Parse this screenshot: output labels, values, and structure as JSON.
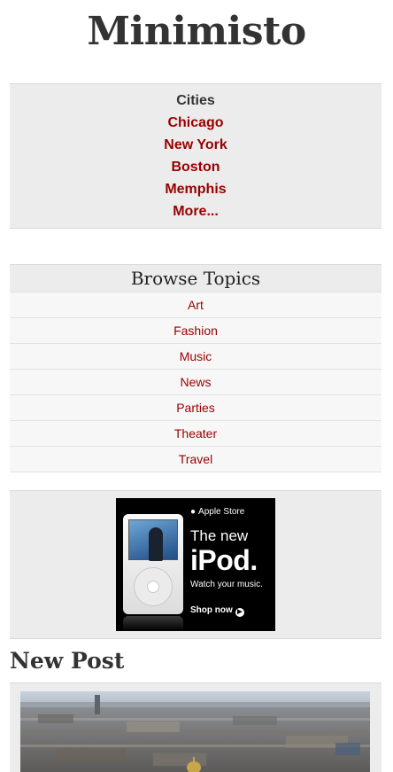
{
  "site": {
    "title": "Minimisto"
  },
  "cities": {
    "heading": "Cities",
    "links": [
      "Chicago",
      "New York",
      "Boston",
      "Memphis",
      "More..."
    ]
  },
  "topics": {
    "heading": "Browse Topics",
    "items": [
      "Art",
      "Fashion",
      "Music",
      "News",
      "Parties",
      "Theater",
      "Travel"
    ]
  },
  "ad": {
    "store": "Apple Store",
    "line1": "The new",
    "line2": "iPod.",
    "line3": "Watch your music.",
    "cta": "Shop now"
  },
  "post": {
    "title": "New Post"
  },
  "colors": {
    "link": "#990000",
    "panel": "#ececec",
    "row": "#f7f7f7",
    "text": "#333333"
  }
}
